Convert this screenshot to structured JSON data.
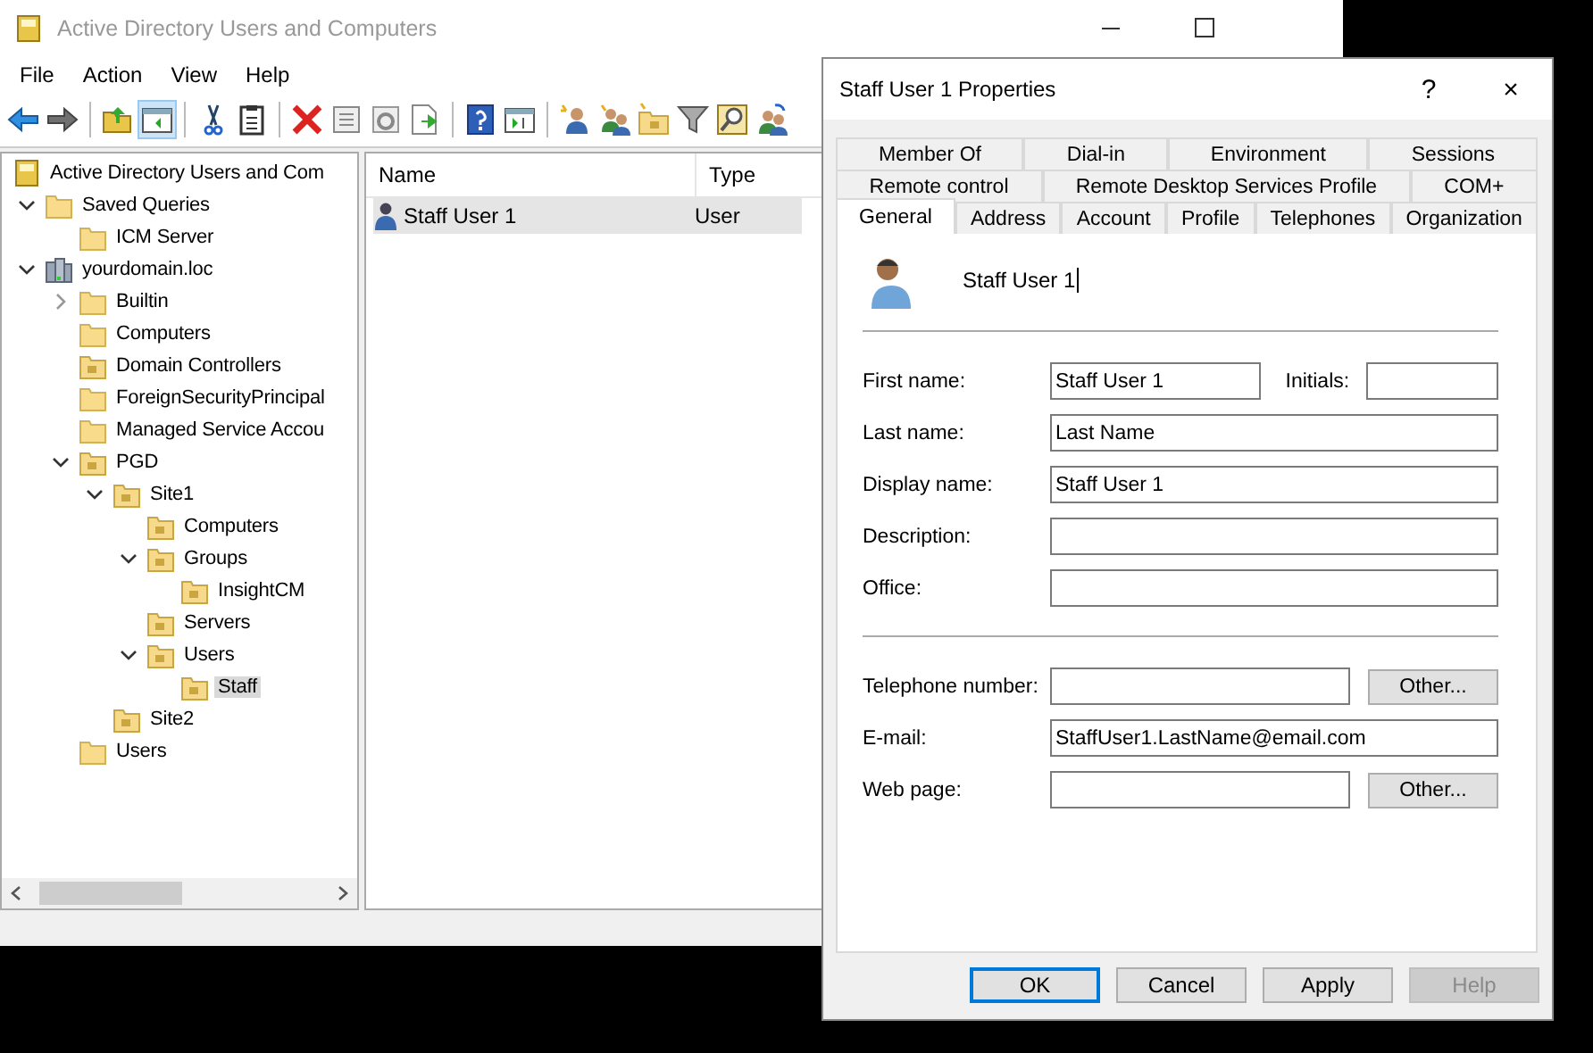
{
  "main_window": {
    "title": "Active Directory Users and Computers",
    "menu": [
      "File",
      "Action",
      "View",
      "Help"
    ],
    "tree": [
      {
        "label": "Active Directory Users and Com",
        "kind": "root",
        "selected": false,
        "children": [
          {
            "label": "Saved Queries",
            "kind": "folder",
            "expanded": true,
            "selected": false,
            "children": [
              {
                "label": "ICM Server",
                "kind": "folder",
                "selected": false
              }
            ]
          },
          {
            "label": "yourdomain.loc",
            "kind": "domain",
            "expanded": true,
            "selected": false,
            "children": [
              {
                "label": "Builtin",
                "kind": "folder",
                "expanded": false,
                "selected": false
              },
              {
                "label": "Computers",
                "kind": "folder",
                "selected": false
              },
              {
                "label": "Domain Controllers",
                "kind": "ou",
                "selected": false
              },
              {
                "label": "ForeignSecurityPrincipal",
                "kind": "folder",
                "selected": false
              },
              {
                "label": "Managed Service Accou",
                "kind": "folder",
                "selected": false
              },
              {
                "label": "PGD",
                "kind": "ou",
                "expanded": true,
                "selected": false,
                "children": [
                  {
                    "label": "Site1",
                    "kind": "ou",
                    "expanded": true,
                    "selected": false,
                    "children": [
                      {
                        "label": "Computers",
                        "kind": "ou",
                        "selected": false
                      },
                      {
                        "label": "Groups",
                        "kind": "ou",
                        "expanded": true,
                        "selected": false,
                        "children": [
                          {
                            "label": "InsightCM",
                            "kind": "ou",
                            "selected": false
                          }
                        ]
                      },
                      {
                        "label": "Servers",
                        "kind": "ou",
                        "selected": false
                      },
                      {
                        "label": "Users",
                        "kind": "ou",
                        "expanded": true,
                        "selected": false,
                        "children": [
                          {
                            "label": "Staff",
                            "kind": "ou",
                            "selected": true
                          }
                        ]
                      }
                    ]
                  },
                  {
                    "label": "Site2",
                    "kind": "ou",
                    "selected": false
                  }
                ]
              },
              {
                "label": "Users",
                "kind": "folder",
                "selected": false
              }
            ]
          }
        ]
      }
    ],
    "list": {
      "columns": [
        "Name",
        "Type"
      ],
      "rows": [
        {
          "cells": [
            "Staff User 1",
            "User"
          ],
          "selected": true
        }
      ]
    }
  },
  "dialog": {
    "title": "Staff User 1 Properties",
    "help_glyph": "?",
    "close_glyph": "×",
    "tab_rows": [
      [
        {
          "label": "Member Of",
          "selected": false
        },
        {
          "label": "Dial-in",
          "selected": false
        },
        {
          "label": "Environment",
          "selected": false
        },
        {
          "label": "Sessions",
          "selected": false
        }
      ],
      [
        {
          "label": "Remote control",
          "selected": false
        },
        {
          "label": "Remote Desktop Services Profile",
          "selected": false
        },
        {
          "label": "COM+",
          "selected": false
        }
      ],
      [
        {
          "label": "General",
          "selected": true
        },
        {
          "label": "Address",
          "selected": false
        },
        {
          "label": "Account",
          "selected": false
        },
        {
          "label": "Profile",
          "selected": false
        },
        {
          "label": "Telephones",
          "selected": false
        },
        {
          "label": "Organization",
          "selected": false
        }
      ]
    ],
    "user_name": "Staff User 1",
    "field_groups": [
      [
        {
          "kind": "split",
          "label": "First name:",
          "value": "Staff User 1",
          "side_label": "Initials:"
        },
        {
          "kind": "text",
          "label": "Last name:",
          "value": "Last Name"
        },
        {
          "kind": "text",
          "label": "Display name:",
          "value": "Staff User 1"
        },
        {
          "kind": "text",
          "label": "Description:"
        },
        {
          "kind": "text",
          "label": "Office:"
        }
      ],
      [
        {
          "kind": "button",
          "label": "Telephone number:",
          "button": "Other..."
        },
        {
          "kind": "text",
          "label": "E-mail:",
          "value": "StaffUser1.LastName@email.com"
        },
        {
          "kind": "button",
          "label": "Web page:",
          "button": "Other..."
        }
      ]
    ],
    "buttons": [
      {
        "label": "OK",
        "default": true,
        "disabled": false
      },
      {
        "label": "Cancel",
        "default": false,
        "disabled": false
      },
      {
        "label": "Apply",
        "default": false,
        "disabled": false
      },
      {
        "label": "Help",
        "default": false,
        "disabled": true
      }
    ]
  }
}
